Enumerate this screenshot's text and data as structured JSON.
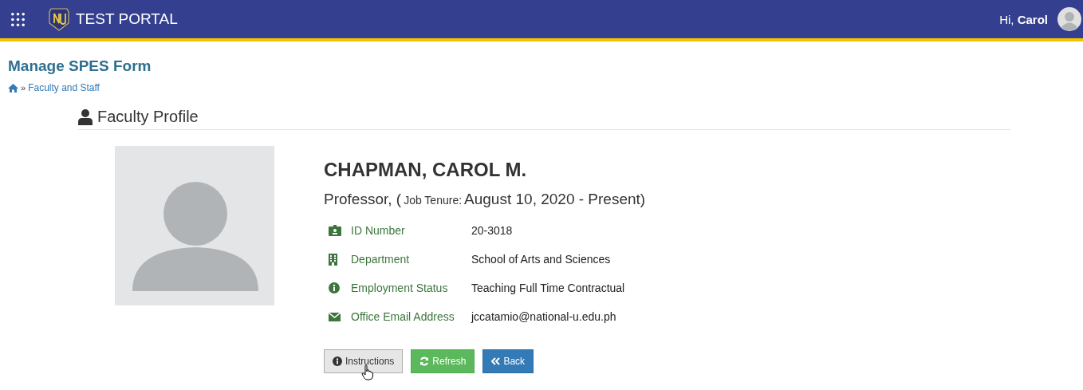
{
  "topbar": {
    "brand": "TEST PORTAL",
    "greeting": "Hi,",
    "user": "Carol"
  },
  "page": {
    "title": "Manage SPES Form",
    "breadcrumb_separator": "»",
    "breadcrumb": [
      "Faculty and Staff"
    ]
  },
  "section": {
    "title": "Faculty Profile"
  },
  "profile": {
    "name": "CHAPMAN, CAROL M.",
    "subtitle_parts": [
      {
        "kind": "large",
        "text": "Professor, ("
      },
      {
        "kind": "small",
        "text": "Job Tenure:"
      },
      {
        "kind": "large",
        "text": "August 10, 2020 - Present)"
      }
    ],
    "details": [
      {
        "kind": "id",
        "label": "ID Number",
        "value": "20-3018"
      },
      {
        "kind": "building",
        "label": "Department",
        "value": "School of Arts and Sciences"
      },
      {
        "kind": "info",
        "label": "Employment Status",
        "value": "Teaching Full Time Contractual"
      },
      {
        "kind": "email",
        "label": "Office Email Address",
        "value": "jccatamio@national-u.edu.ph"
      }
    ]
  },
  "buttons": [
    {
      "kind": "default",
      "label": "Instructions",
      "hovered": true
    },
    {
      "kind": "success",
      "label": "Refresh",
      "hovered": false
    },
    {
      "kind": "primary",
      "label": "Back",
      "hovered": false
    }
  ]
}
